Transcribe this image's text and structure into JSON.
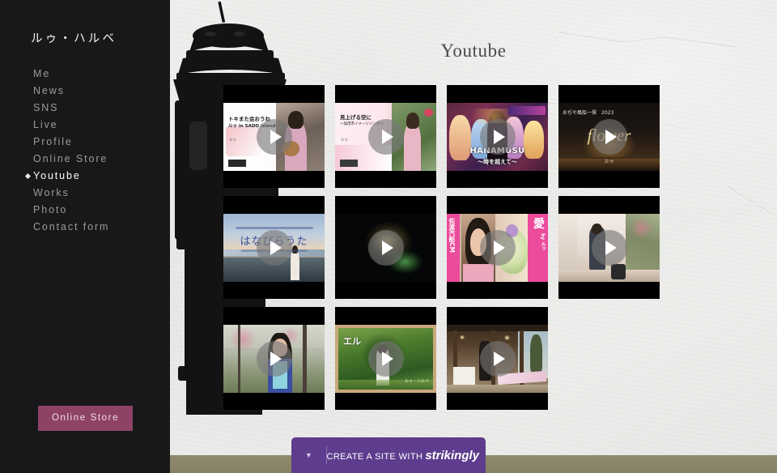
{
  "sidebar": {
    "site_title": "ルゥ・ハルベ",
    "nav_items": [
      {
        "label": "Me",
        "active": false
      },
      {
        "label": "News",
        "active": false
      },
      {
        "label": "SNS",
        "active": false
      },
      {
        "label": "Live",
        "active": false
      },
      {
        "label": "Profile",
        "active": false
      },
      {
        "label": "Online Store",
        "active": false
      },
      {
        "label": "Youtube",
        "active": true
      },
      {
        "label": "Works",
        "active": false
      },
      {
        "label": "Photo",
        "active": false
      },
      {
        "label": "Contact form",
        "active": false
      }
    ],
    "store_button_label": "Online Store",
    "store_button_color": "#8e4266",
    "background_color": "#18181a",
    "active_bullet_icon": "diamond-bullet-icon"
  },
  "main": {
    "page_title": "Youtube",
    "background_description": "white textured plaster wall with dark vintage lamp post",
    "floor_band_color": "#8a8568",
    "title_color": "#4a4a4a"
  },
  "videos": {
    "play_icon": "play-triangle-icon",
    "rows": [
      [
        {
          "name": "toki-mata-aoune",
          "title_lines": [
            "トキまた会おうね",
            "ルゥ in SADO island"
          ],
          "byline": "ルゥ",
          "style": "light-card"
        },
        {
          "name": "miageru-sora-ni",
          "title_lines": [
            "見上げる空に",
            "〜加茂市イメージソング〜"
          ],
          "byline": "ルゥ",
          "style": "pink-card"
        },
        {
          "name": "hanamusu-toki-wo-koete",
          "title_lines": [
            "HANAMUSU",
            "〜時を超えて〜"
          ],
          "byline": "",
          "style": "anime-card"
        },
        {
          "name": "ojiya-fusen-ikki-2023-flower",
          "title_lines": [
            "おぢや風船一揆　2023",
            "flower"
          ],
          "byline": "ルゥ",
          "style": "night-card"
        }
      ],
      [
        {
          "name": "hanabira-uta",
          "title_lines": [
            "はなびらうた"
          ],
          "byline": "",
          "style": "sunset-card"
        },
        {
          "name": "fireworks-night",
          "title_lines": [],
          "byline": "",
          "style": "fireworks-card"
        },
        {
          "name": "sadokisen-cm-ai",
          "title_lines": [
            "佐渡汽船CM",
            "愛",
            "by ルゥ"
          ],
          "byline": "",
          "style": "cm-card"
        },
        {
          "name": "shop-interior-live",
          "title_lines": [],
          "byline": "",
          "style": "shop-card"
        }
      ],
      [
        {
          "name": "sakura-outdoor",
          "title_lines": [],
          "byline": "",
          "style": "sakura-card"
        },
        {
          "name": "eru-green-forest",
          "title_lines": [
            "エル"
          ],
          "byline": "ルゥ・ハルベ",
          "style": "forest-card"
        },
        {
          "name": "pavilion-live",
          "title_lines": [],
          "byline": "",
          "style": "pavilion-card"
        }
      ]
    ]
  },
  "strikingly": {
    "chevron_icon": "chevron-down-icon",
    "prefix_text": "CREATE A SITE WITH",
    "brand": "strikingly",
    "background_color": "#5e3d8e"
  }
}
